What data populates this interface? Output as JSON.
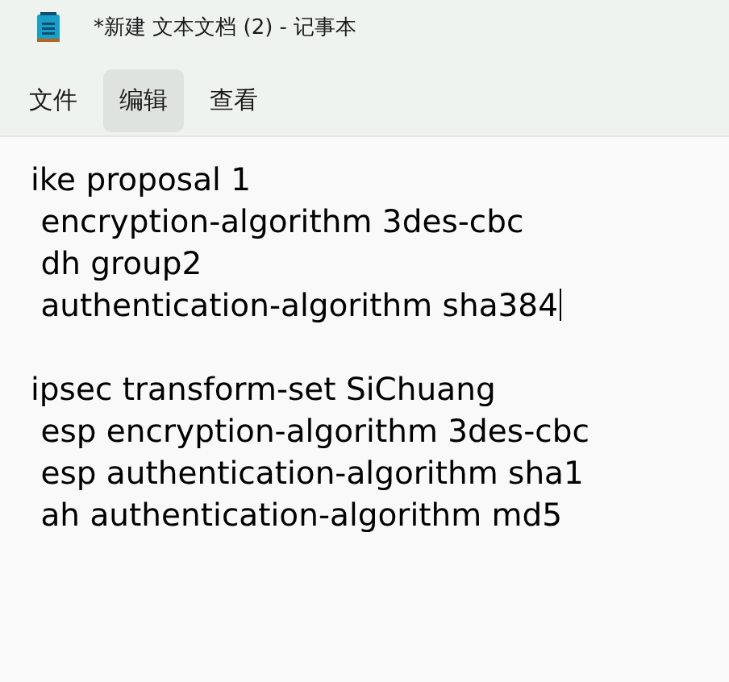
{
  "window": {
    "title": "*新建 文本文档 (2) - 记事本"
  },
  "menu": [
    {
      "label": "文件",
      "selected": false
    },
    {
      "label": "编辑",
      "selected": true
    },
    {
      "label": "查看",
      "selected": false
    }
  ],
  "editor": {
    "paragraphs": [
      {
        "lines": [
          {
            "text": "ike proposal 1",
            "caret": false
          },
          {
            "text": " encryption-algorithm 3des-cbc",
            "caret": false
          },
          {
            "text": " dh group2",
            "caret": false
          },
          {
            "text": " authentication-algorithm sha384",
            "caret": true
          }
        ]
      },
      {
        "lines": [
          {
            "text": "ipsec transform-set SiChuang",
            "caret": false
          },
          {
            "text": " esp encryption-algorithm 3des-cbc",
            "caret": false
          },
          {
            "text": " esp authentication-algorithm sha1",
            "caret": false
          },
          {
            "text": " ah authentication-algorithm md5",
            "caret": false
          }
        ]
      }
    ]
  }
}
